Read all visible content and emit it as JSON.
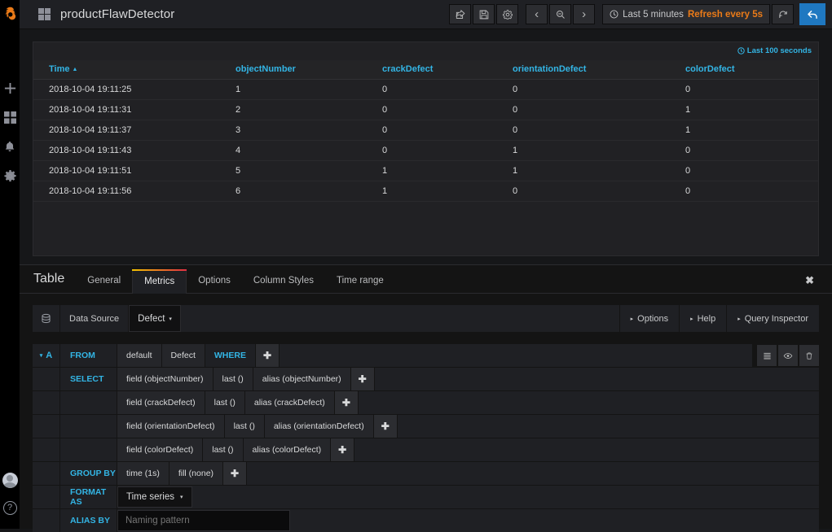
{
  "sidenav": {
    "logo": "grafana-logo",
    "items": [
      {
        "name": "create-icon",
        "glyph": "✚"
      },
      {
        "name": "dashboards-icon",
        "glyph": "grid"
      },
      {
        "name": "alerting-icon",
        "glyph": "🔔"
      },
      {
        "name": "configuration-icon",
        "glyph": "⚙"
      }
    ],
    "avatar_label": "user-avatar",
    "help_label": "?"
  },
  "topbar": {
    "dashboard_title": "productFlawDetector",
    "share_label": "↱",
    "save_label": "💾",
    "settings_label": "⚙",
    "zoom_back_label": "‹",
    "zoom_out_label": "🔍",
    "zoom_fwd_label": "›",
    "clock_label": "◷",
    "time_range": "Last 5 minutes",
    "refresh_interval": "Refresh every 5s",
    "refresh_label": "↻",
    "back_label": "↩"
  },
  "panel": {
    "time_info": "Last 100 seconds",
    "clock_glyph": "◷",
    "sort_caret": "▲",
    "columns": [
      "Time",
      "objectNumber",
      "crackDefect",
      "orientationDefect",
      "colorDefect"
    ],
    "rows": [
      [
        "2018-10-04 19:11:25",
        "1",
        "0",
        "0",
        "0"
      ],
      [
        "2018-10-04 19:11:31",
        "2",
        "0",
        "0",
        "1"
      ],
      [
        "2018-10-04 19:11:37",
        "3",
        "0",
        "0",
        "1"
      ],
      [
        "2018-10-04 19:11:43",
        "4",
        "0",
        "1",
        "0"
      ],
      [
        "2018-10-04 19:11:51",
        "5",
        "1",
        "1",
        "0"
      ],
      [
        "2018-10-04 19:11:56",
        "6",
        "1",
        "0",
        "0"
      ]
    ]
  },
  "editor": {
    "panel_type": "Table",
    "tabs": [
      {
        "label": "General",
        "active": false
      },
      {
        "label": "Metrics",
        "active": true
      },
      {
        "label": "Options",
        "active": false
      },
      {
        "label": "Column Styles",
        "active": false
      },
      {
        "label": "Time range",
        "active": false
      }
    ],
    "close_label": "✖",
    "datasource": {
      "db_icon": "⛁",
      "label": "Data Source",
      "selected": "Defect",
      "caret": "▾",
      "options_label": "Options",
      "help_label": "Help",
      "query_inspector_label": "Query Inspector",
      "caret_right": "▸"
    },
    "query": {
      "ref_id": "A",
      "collapse_caret": "▾",
      "from_label": "FROM",
      "from_policy": "default",
      "from_measurement": "Defect",
      "where_label": "WHERE",
      "plus": "✚",
      "actions": {
        "menu": "☰",
        "eye": "👁",
        "trash": "🗑"
      },
      "select_label": "SELECT",
      "select_rows": [
        {
          "field": "field (objectNumber)",
          "func": "last ()",
          "alias": "alias (objectNumber)"
        },
        {
          "field": "field (crackDefect)",
          "func": "last ()",
          "alias": "alias (crackDefect)"
        },
        {
          "field": "field (orientationDefect)",
          "func": "last ()",
          "alias": "alias (orientationDefect)"
        },
        {
          "field": "field (colorDefect)",
          "func": "last ()",
          "alias": "alias (colorDefect)"
        }
      ],
      "group_by_label": "GROUP BY",
      "group_by_time": "time (1s)",
      "group_by_fill": "fill (none)",
      "format_as_label": "FORMAT AS",
      "format_as_value": "Time series",
      "alias_by_label": "ALIAS BY",
      "alias_by_placeholder": "Naming pattern"
    }
  },
  "colors": {
    "accent_blue": "#33b5e5",
    "brand_orange": "#eb7b18",
    "primary_button": "#1f78c1",
    "tab_gradient_start": "#f2c200",
    "tab_gradient_end": "#e02f44"
  }
}
